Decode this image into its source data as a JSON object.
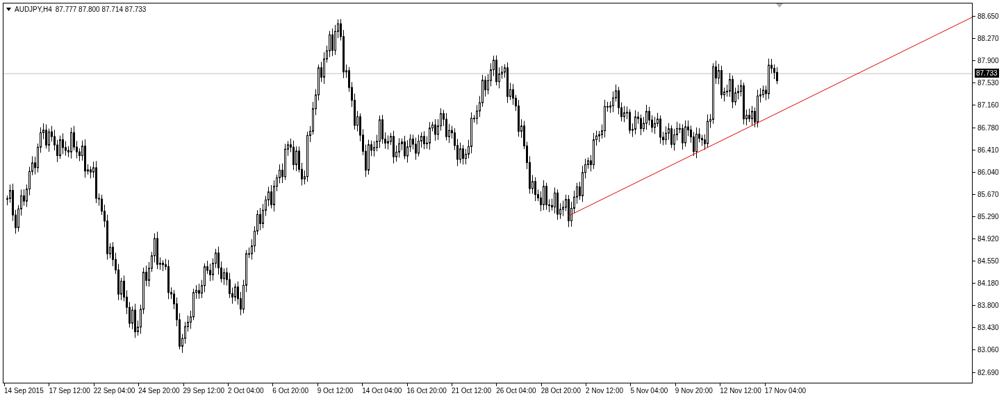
{
  "chart": {
    "symbol": "AUDJPY,H4",
    "quotes": "87.777 87.800 87.714 87.733",
    "current_price": "87.733",
    "price_ticks": [
      "88.650",
      "88.270",
      "87.900",
      "87.530",
      "87.160",
      "86.780",
      "86.410",
      "86.040",
      "85.670",
      "85.290",
      "84.920",
      "84.550",
      "84.180",
      "83.800",
      "83.430",
      "83.060",
      "82.690"
    ],
    "time_ticks": [
      "14 Sep 2015",
      "17 Sep 12:00",
      "22 Sep 04:00",
      "24 Sep 20:00",
      "29 Sep 12:00",
      "2 Oct 04:00",
      "6 Oct 20:00",
      "9 Oct 12:00",
      "14 Oct 04:00",
      "16 Oct 20:00",
      "21 Oct 12:00",
      "26 Oct 04:00",
      "28 Oct 20:00",
      "2 Nov 12:00",
      "5 Nov 04:00",
      "9 Nov 20:00",
      "12 Nov 12:00",
      "17 Nov 04:00"
    ]
  }
}
